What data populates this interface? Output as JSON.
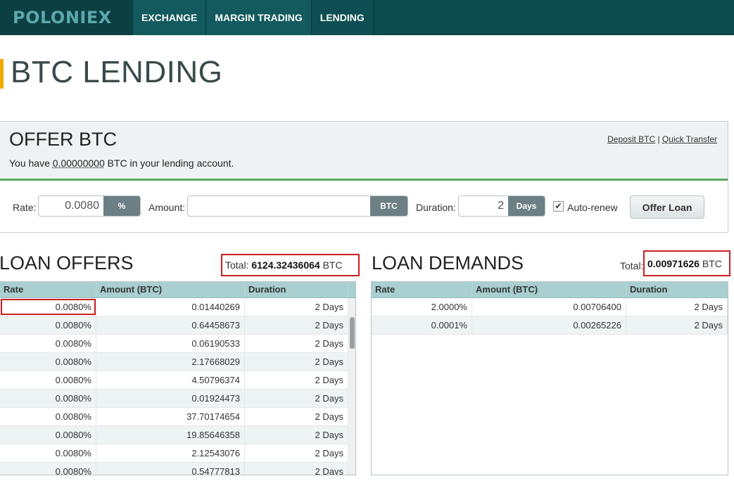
{
  "nav": {
    "logo": "POLONIEX",
    "items": [
      "EXCHANGE",
      "MARGIN TRADING",
      "LENDING"
    ],
    "active_index": 2
  },
  "page": {
    "title": "BTC LENDING"
  },
  "offer": {
    "title": "OFFER BTC",
    "sub_prefix": "You have",
    "balance": "0.00000000",
    "sub_suffix": "BTC in your lending account.",
    "links": {
      "deposit": "Deposit BTC",
      "separator": "|",
      "transfer": "Quick Transfer"
    },
    "form": {
      "rate_label": "Rate:",
      "rate_value": "0.0080",
      "rate_unit": "%",
      "amount_label": "Amount:",
      "amount_value": "",
      "amount_unit": "BTC",
      "duration_label": "Duration:",
      "duration_value": "2",
      "duration_unit": "Days",
      "autorenew_label": "Auto-renew",
      "autorenew_checked": true,
      "submit_label": "Offer Loan"
    }
  },
  "loan_offers": {
    "title": "LOAN OFFERS",
    "total_label": "Total:",
    "total_value": "6124.32436064",
    "total_unit": "BTC",
    "columns": [
      "Rate",
      "Amount (BTC)",
      "Duration"
    ],
    "rows": [
      [
        "0.0080%",
        "0.01440269",
        "2 Days"
      ],
      [
        "0.0080%",
        "0.64458673",
        "2 Days"
      ],
      [
        "0.0080%",
        "0.06190533",
        "2 Days"
      ],
      [
        "0.0080%",
        "2.17668029",
        "2 Days"
      ],
      [
        "0.0080%",
        "4.50796374",
        "2 Days"
      ],
      [
        "0.0080%",
        "0.01924473",
        "2 Days"
      ],
      [
        "0.0080%",
        "37.70174654",
        "2 Days"
      ],
      [
        "0.0080%",
        "19.85646358",
        "2 Days"
      ],
      [
        "0.0080%",
        "2.12543076",
        "2 Days"
      ],
      [
        "0.0080%",
        "0.54777813",
        "2 Days"
      ]
    ]
  },
  "loan_demands": {
    "title": "LOAN DEMANDS",
    "total_label": "Total:",
    "total_value": "0.00971626",
    "total_unit": "BTC",
    "columns": [
      "Rate",
      "Amount (BTC)",
      "Duration"
    ],
    "rows": [
      [
        "2.0000%",
        "0.00706400",
        "2 Days"
      ],
      [
        "0.0001%",
        "0.00265226",
        "2 Days"
      ]
    ]
  },
  "colors": {
    "nav_bg": "#0d4a4d",
    "accent_bar": "#f2a900",
    "highlight": "#cc1f1f",
    "table_header": "#a9cfd0"
  }
}
